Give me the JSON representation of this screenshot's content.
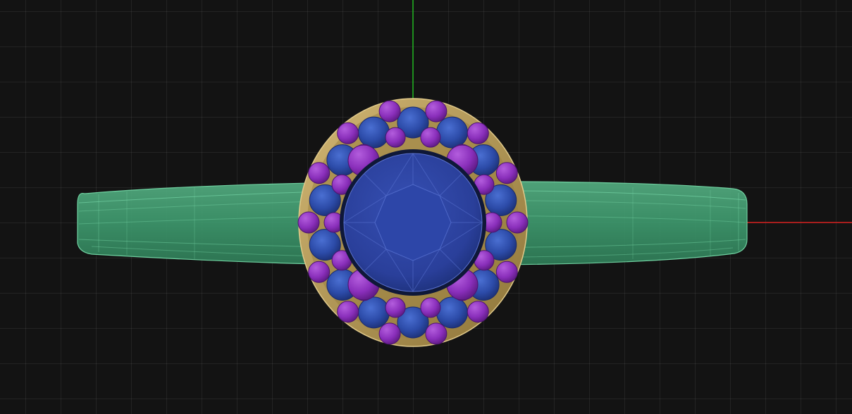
{
  "viewport": {
    "background": "#131313",
    "grid_color": "#2a2a2a",
    "axes": {
      "x_axis_color": "#d8201e",
      "y_axis_color": "#1fb61f"
    }
  },
  "model": {
    "band_color": "#3e9a6e",
    "bezel_color": "#b79b55",
    "center_stone_color": "#2a3f9a",
    "halo_stone_color": "#2c4ba8",
    "accent_bead_color": "#8a2fbb"
  }
}
